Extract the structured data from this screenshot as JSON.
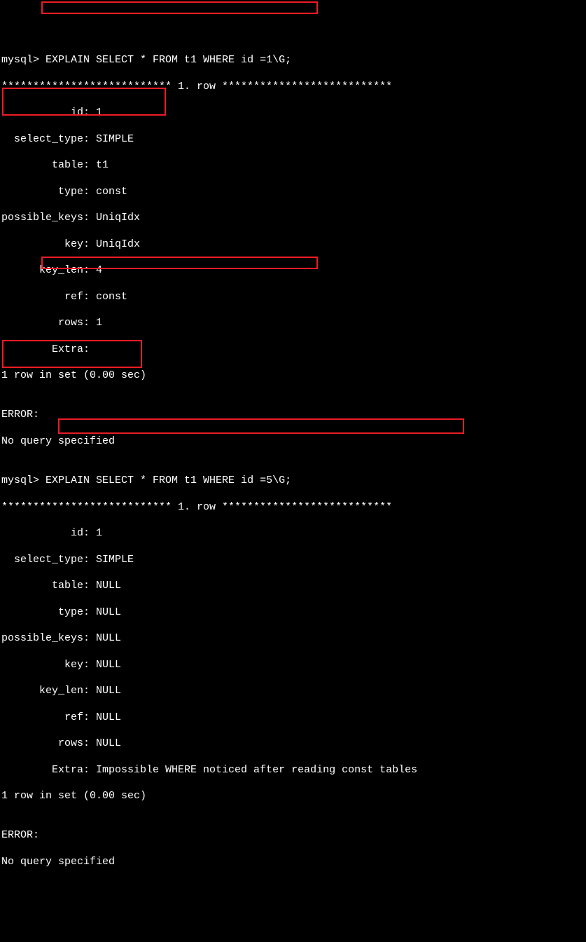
{
  "q1": {
    "prompt": "mysql> ",
    "command": "EXPLAIN SELECT * FROM t1 WHERE id =1\\G;",
    "rowhdr": "*************************** 1. row ***************************",
    "fields": {
      "id": "           id: 1",
      "select_type": "  select_type: SIMPLE",
      "table": "        table: t1",
      "type": "         type: const",
      "possible_keys": "possible_keys: UniqIdx",
      "key": "          key: UniqIdx",
      "key_len": "      key_len: 4",
      "ref": "          ref: const",
      "rows": "         rows: 1",
      "extra": "        Extra:"
    },
    "footer": "1 row in set (0.00 sec)",
    "blank": "",
    "error1": "ERROR:",
    "error2": "No query specified"
  },
  "q2": {
    "prompt": "mysql> ",
    "command": "EXPLAIN SELECT * FROM t1 WHERE id =5\\G;",
    "rowhdr": "*************************** 1. row ***************************",
    "fields": {
      "id": "           id: 1",
      "select_type": "  select_type: SIMPLE",
      "table": "        table: NULL",
      "type": "         type: NULL",
      "possible_keys": "possible_keys: NULL",
      "key": "          key: NULL",
      "key_len": "      key_len: NULL",
      "ref": "          ref: NULL",
      "rows": "         rows: NULL",
      "extra": "        Extra: Impossible WHERE noticed after reading const tables"
    },
    "footer": "1 row in set (0.00 sec)",
    "blank": "",
    "error1": "ERROR:",
    "error2": "No query specified"
  }
}
